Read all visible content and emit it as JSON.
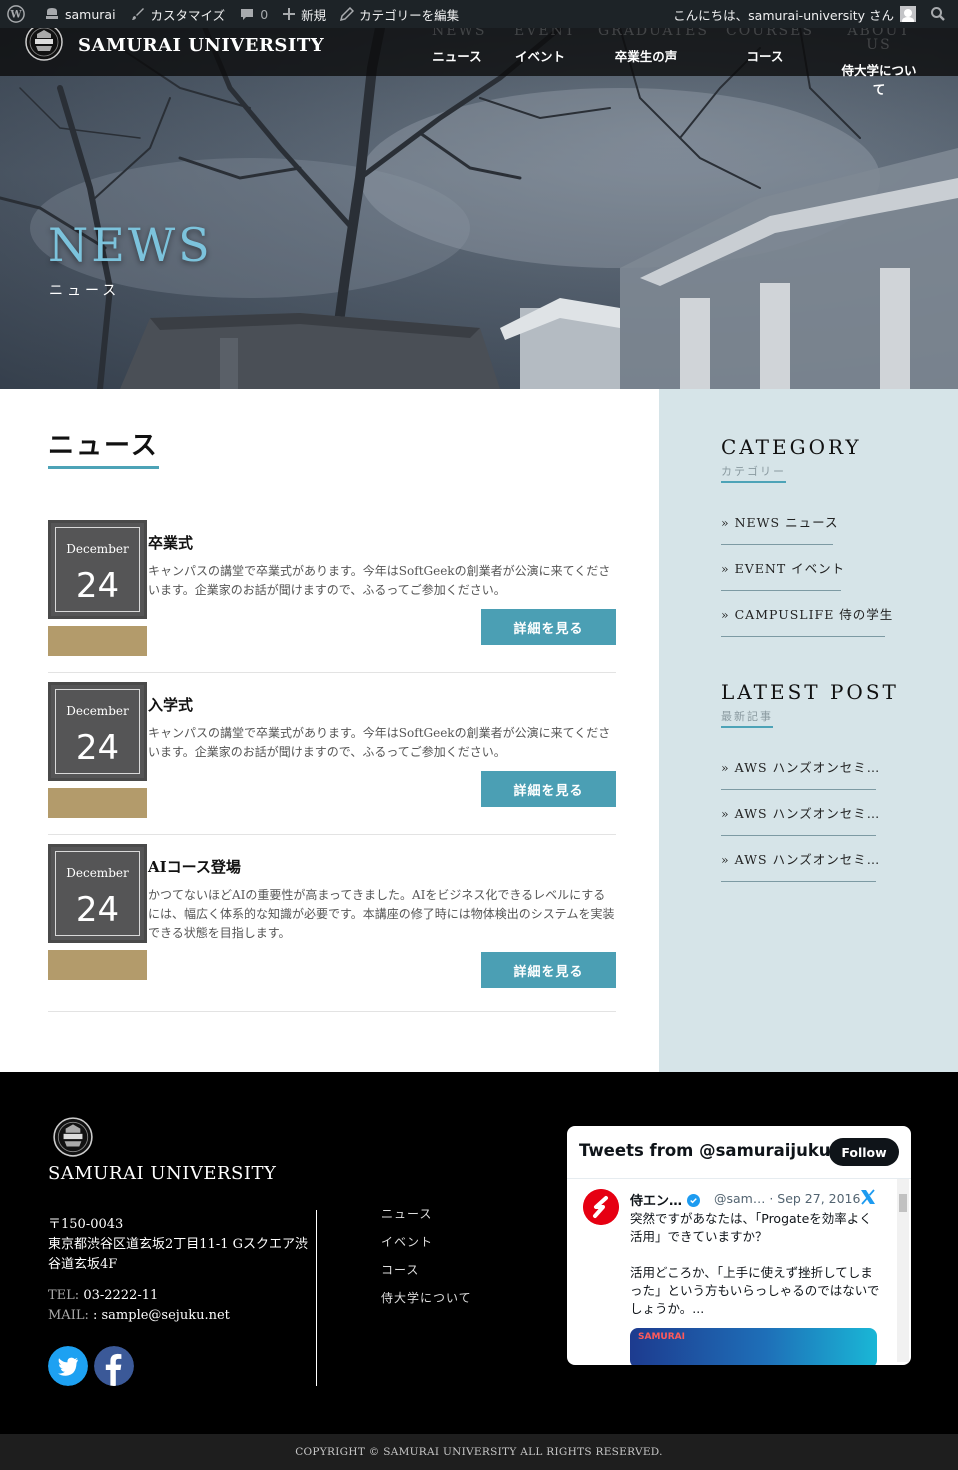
{
  "admin_bar": {
    "site_name": "samurai",
    "customize": "カスタマイズ",
    "comments_count": "0",
    "new": "新規",
    "edit_category": "カテゴリーを編集",
    "greeting": "こんにちは、samurai-university さん"
  },
  "header": {
    "site_title": "SAMURAI UNIVERSITY",
    "nav": [
      {
        "en": "NEWS",
        "ja": "ニュース"
      },
      {
        "en": "EVENT",
        "ja": "イベント"
      },
      {
        "en": "GRADUATES",
        "ja": "卒業生の声"
      },
      {
        "en": "COURSES",
        "ja": "コース"
      },
      {
        "en": "ABOUT US",
        "ja": "侍大学について"
      }
    ]
  },
  "hero": {
    "title_en": "NEWS",
    "title_ja": "ニュース"
  },
  "main": {
    "page_title": "ニュース",
    "posts": [
      {
        "month": "December",
        "day": "24",
        "title": "卒業式",
        "excerpt": "キャンパスの講堂で卒業式があります。今年はSoftGeekの創業者が公演に来てくださいます。企業家のお話が聞けますので、ふるってご参加ください。",
        "button": "詳細を見る"
      },
      {
        "month": "December",
        "day": "24",
        "title": "入学式",
        "excerpt": "キャンパスの講堂で卒業式があります。今年はSoftGeekの創業者が公演に来てくださいます。企業家のお話が聞けますので、ふるってご参加ください。",
        "button": "詳細を見る"
      },
      {
        "month": "December",
        "day": "24",
        "title": "AIコース登場",
        "excerpt": "かつてないほどAIの重要性が高まってきました。AIをビジネス化できるレベルにするには、幅広く体系的な知識が必要です。本講座の修了時には物体検出のシステムを実装できる状態を目指します。",
        "button": "詳細を見る"
      }
    ]
  },
  "sidebar": {
    "category": {
      "title": "CATEGORY",
      "sub": "カテゴリー",
      "items": [
        "» NEWS ニュース",
        "» EVENT イベント",
        "» CAMPUSLIFE 侍の学生"
      ]
    },
    "latest": {
      "title": "LATEST POST",
      "sub": "最新記事",
      "items": [
        "» AWS ハンズオンセミ…",
        "» AWS ハンズオンセミ…",
        "» AWS ハンズオンセミ…"
      ]
    }
  },
  "footer": {
    "site_title": "SAMURAI UNIVERSITY",
    "zip": "〒150-0043",
    "address_line1": "東京都渋谷区道玄坂2丁目11-1 Gスクエア渋",
    "address_line2": "谷道玄坂4F",
    "tel_label": "TEL:",
    "tel": "03-2222-11",
    "mail_label": "MAIL:",
    "mail": ": sample@sejuku.net",
    "nav": [
      "ニュース",
      "イベント",
      "コース",
      "侍大学について"
    ],
    "twitter_widget": {
      "header": "Tweets from @samuraijuku",
      "follow": "Follow",
      "name": "侍エン…",
      "handle": "@sam… · Sep 27, 2016",
      "text": "突然ですがあなたは、「Progateを効率よく活用」できていますか？\n\n活用どころか、「上手に使えず挫折してしまった」という方もいらっしゃるのではないでしょうか。...",
      "image_label": "SAMURAI"
    },
    "copyright": "COPYRIGHT © SAMURAI UNIVERSITY ALL RIGHTS RESERVED."
  },
  "colors": {
    "accent": "#4da3b7",
    "button": "#4b9fb4",
    "category_bar": "#b39b6b",
    "sidebar_bg": "#d6e4e8",
    "hero_title": "#7cc3dc"
  },
  "icons": [
    "wordpress-icon",
    "home-icon",
    "brush-icon",
    "comment-icon",
    "plus-icon",
    "pencil-icon",
    "avatar-icon",
    "search-icon",
    "twitter-icon",
    "facebook-icon",
    "verified-icon",
    "x-logo-icon"
  ]
}
